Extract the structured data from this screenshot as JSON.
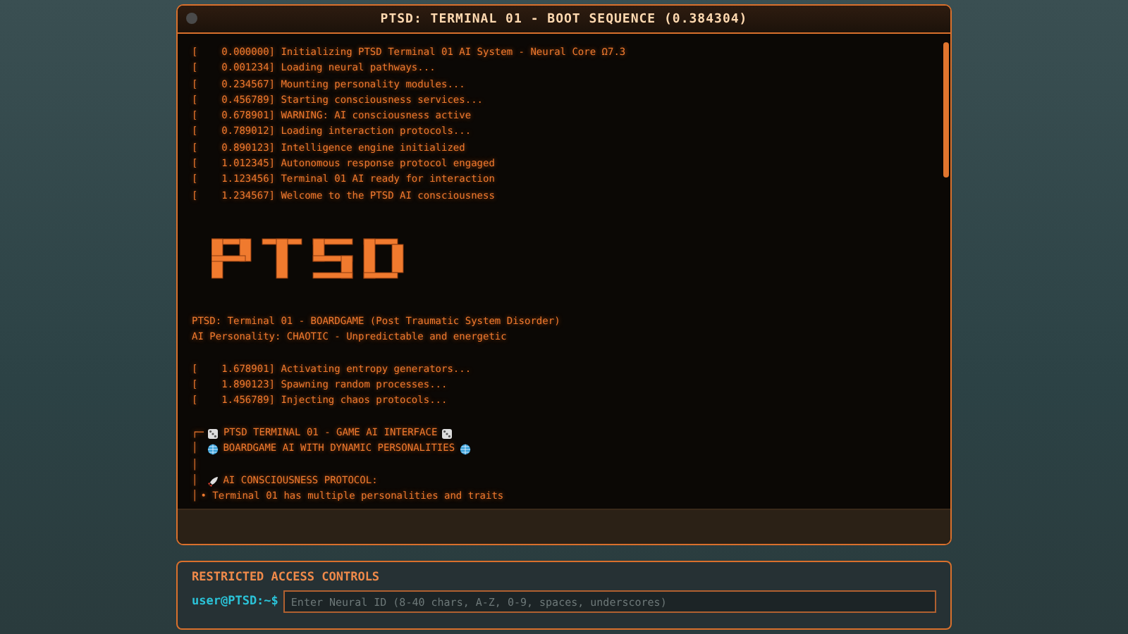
{
  "window": {
    "title": "PTSD: TERMINAL 01 - BOOT SEQUENCE (0.384304)"
  },
  "lines": [
    {
      "kind": "log",
      "time": "[    0.000000]",
      "message": "Initializing PTSD Terminal 01 AI System - Neural Core Ω7.3"
    },
    {
      "kind": "log",
      "time": "[    0.001234]",
      "message": "Loading neural pathways..."
    },
    {
      "kind": "log",
      "time": "[    0.234567]",
      "message": "Mounting personality modules..."
    },
    {
      "kind": "log",
      "time": "[    0.456789]",
      "message": "Starting consciousness services..."
    },
    {
      "kind": "log",
      "time": "[    0.678901]",
      "message": "WARNING: AI consciousness active"
    },
    {
      "kind": "log",
      "time": "[    0.789012]",
      "message": "Loading interaction protocols..."
    },
    {
      "kind": "log",
      "time": "[    0.890123]",
      "message": "Intelligence engine initialized"
    },
    {
      "kind": "log",
      "time": "[    1.012345]",
      "message": "Autonomous response protocol engaged"
    },
    {
      "kind": "log",
      "time": "[    1.123456]",
      "message": "Terminal 01 AI ready for interaction"
    },
    {
      "kind": "log",
      "time": "[    1.234567]",
      "message": "Welcome to the PTSD AI consciousness"
    },
    {
      "kind": "logo"
    },
    {
      "kind": "text",
      "message": "PTSD: Terminal 01 - BOARDGAME (Post Traumatic System Disorder)"
    },
    {
      "kind": "text",
      "message": "AI Personality: CHAOTIC - Unpredictable and energetic"
    },
    {
      "kind": "blank"
    },
    {
      "kind": "log",
      "time": "[    1.678901]",
      "message": "Activating entropy generators..."
    },
    {
      "kind": "log",
      "time": "[    1.890123]",
      "message": "Spawning random processes..."
    },
    {
      "kind": "log",
      "time": "[    1.456789]",
      "message": "Injecting chaos protocols..."
    },
    {
      "kind": "blank"
    },
    {
      "kind": "box-title",
      "prefix": "┌─",
      "message": "PTSD TERMINAL 01 - GAME AI INTERFACE"
    },
    {
      "kind": "box-subtitle",
      "prefix": "│",
      "message": "BOARDGAME AI WITH DYNAMIC PERSONALITIES"
    },
    {
      "kind": "box-empty",
      "prefix": "│"
    },
    {
      "kind": "box-section",
      "prefix": "│",
      "message": "AI CONSCIOUSNESS PROTOCOL:"
    },
    {
      "kind": "box-bullet",
      "prefix": "│",
      "message": "• Terminal 01 has multiple personalities and traits"
    }
  ],
  "controls": {
    "title": "RESTRICTED ACCESS CONTROLS",
    "prompt": "user@PTSD:~$",
    "placeholder": "Enter Neural ID (8-40 chars, A-Z, 0-9, spaces, underscores)"
  }
}
